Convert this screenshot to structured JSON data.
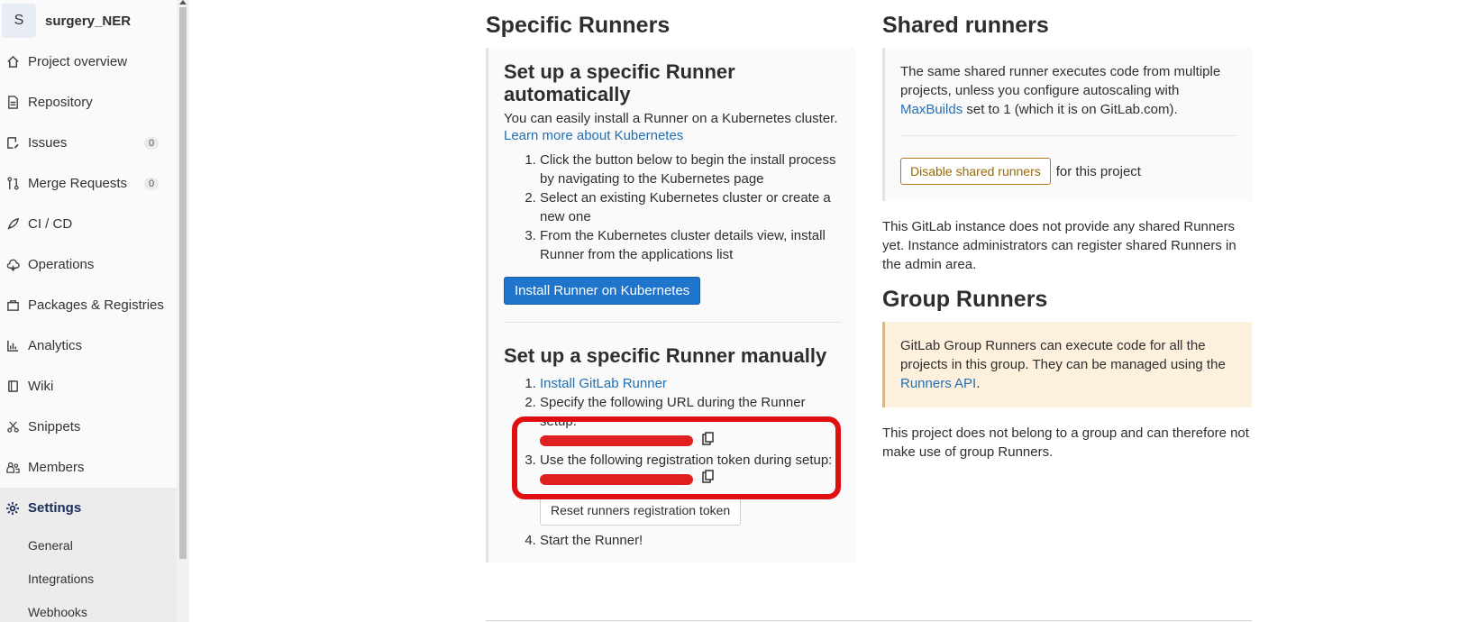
{
  "sidebar": {
    "project_initial": "S",
    "project_name": "surgery_NER",
    "items": [
      {
        "label": "Project overview",
        "icon": "home-icon"
      },
      {
        "label": "Repository",
        "icon": "doc-icon"
      },
      {
        "label": "Issues",
        "icon": "issues-icon",
        "badge": "0"
      },
      {
        "label": "Merge Requests",
        "icon": "merge-icon",
        "badge": "0"
      },
      {
        "label": "CI / CD",
        "icon": "rocket-icon"
      },
      {
        "label": "Operations",
        "icon": "cloud-icon"
      },
      {
        "label": "Packages & Registries",
        "icon": "package-icon"
      },
      {
        "label": "Analytics",
        "icon": "chart-icon"
      },
      {
        "label": "Wiki",
        "icon": "book-icon"
      },
      {
        "label": "Snippets",
        "icon": "scissors-icon"
      },
      {
        "label": "Members",
        "icon": "users-icon"
      },
      {
        "label": "Settings",
        "icon": "gear-icon"
      }
    ],
    "sub_items": [
      "General",
      "Integrations",
      "Webhooks"
    ]
  },
  "specific": {
    "heading": "Specific Runners",
    "auto_title": "Set up a specific Runner automatically",
    "auto_desc": "You can easily install a Runner on a Kubernetes cluster.",
    "auto_link": "Learn more about Kubernetes",
    "auto_steps": [
      "Click the button below to begin the install process by navigating to the Kubernetes page",
      "Select an existing Kubernetes cluster or create a new one",
      "From the Kubernetes cluster details view, install Runner from the applications list"
    ],
    "install_button": "Install Runner on Kubernetes",
    "manual_title": "Set up a specific Runner manually",
    "manual_step1_link": "Install GitLab Runner",
    "manual_step2": "Specify the following URL during the Runner setup:",
    "manual_step3": "Use the following registration token during setup:",
    "reset_button": "Reset runners registration token",
    "manual_step4": "Start the Runner!"
  },
  "shared": {
    "heading": "Shared runners",
    "desc_before": "The same shared runner executes code from multiple projects, unless you configure autoscaling with ",
    "desc_link": "MaxBuilds",
    "desc_after": " set to 1 (which it is on GitLab.com).",
    "disable_button": "Disable shared runners",
    "disable_suffix": "for this project",
    "none_text": "This GitLab instance does not provide any shared Runners yet. Instance administrators can register shared Runners in the admin area."
  },
  "group": {
    "heading": "Group Runners",
    "desc_before": "GitLab Group Runners can execute code for all the projects in this group. They can be managed using the ",
    "desc_link": "Runners API",
    "desc_after": ".",
    "note": "This project does not belong to a group and can therefore not make use of group Runners."
  },
  "colors": {
    "primary": "#1f75cb",
    "link": "#1f6fb5",
    "warning_border": "#b07a1c",
    "highlight": "#e01010",
    "warn_bg": "#fdf1dd"
  }
}
